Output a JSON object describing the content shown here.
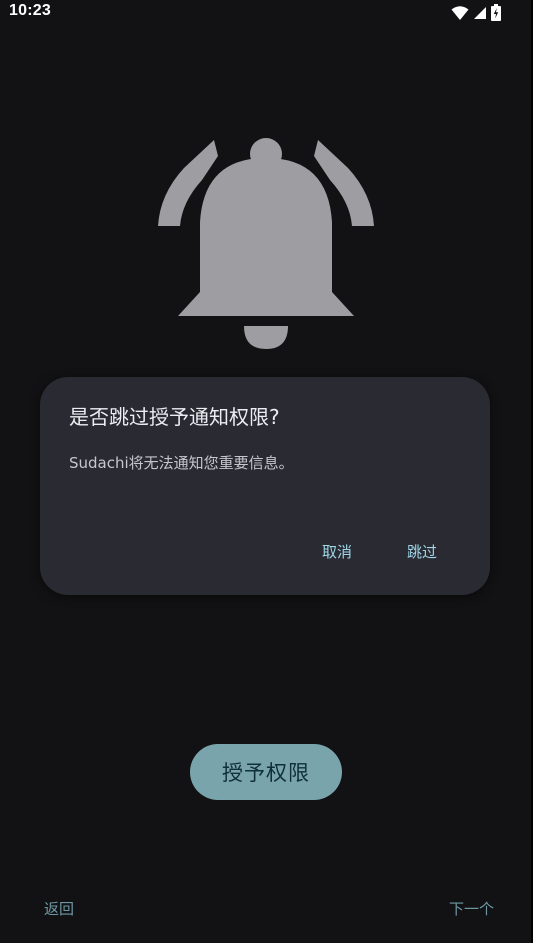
{
  "status_bar": {
    "time": "10:23",
    "icons": [
      "wifi-icon",
      "signal-icon",
      "battery-charging-icon"
    ]
  },
  "illustration": {
    "icon": "notification-bell-ringing-icon",
    "color": "#9e9ea2"
  },
  "dialog": {
    "title": "是否跳过授予通知权限?",
    "message": "Sudachi将无法通知您重要信息。",
    "cancel_label": "取消",
    "skip_label": "跳过"
  },
  "main": {
    "grant_label": "授予权限"
  },
  "footer": {
    "back_label": "返回",
    "next_label": "下一个"
  },
  "colors": {
    "background": "#121214",
    "dialog_bg": "#2a2a32",
    "accent_text": "#9fd7e8",
    "grant_button_bg": "#7aa4ab",
    "nav_text": "#6d98a3"
  }
}
